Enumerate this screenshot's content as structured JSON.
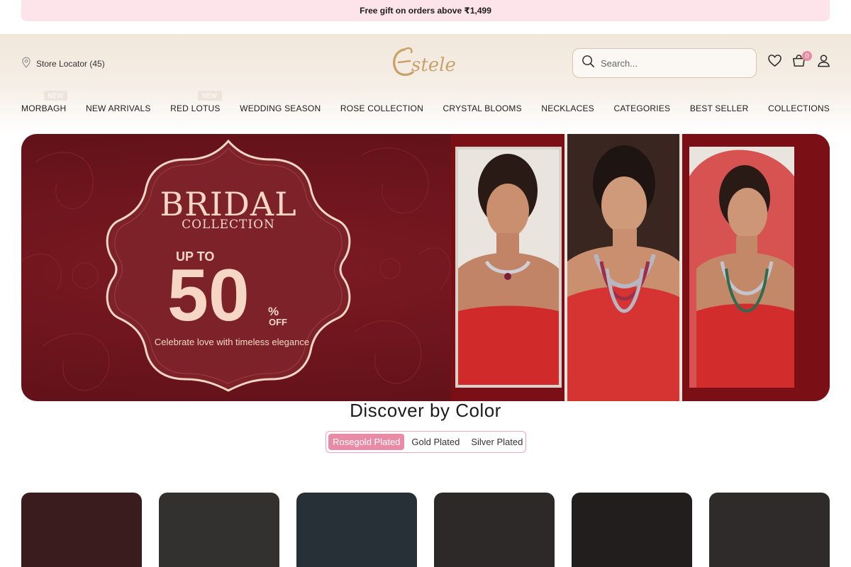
{
  "announcement": {
    "text": "Free gift on orders above ₹1,499"
  },
  "header": {
    "store_locator": "Store Locator (45)",
    "logo_text": "Estele",
    "search_placeholder": "Search...",
    "cart_count": "0"
  },
  "nav": {
    "items": [
      {
        "label": "MORBAGH",
        "badge": "NEW"
      },
      {
        "label": "NEW ARRIVALS"
      },
      {
        "label": "RED LOTUS",
        "badge": "NEW"
      },
      {
        "label": "WEDDING SEASON"
      },
      {
        "label": "ROSE COLLECTION"
      },
      {
        "label": "CRYSTAL BLOOMS"
      },
      {
        "label": "NECKLACES"
      },
      {
        "label": "CATEGORIES"
      },
      {
        "label": "BEST SELLER"
      },
      {
        "label": "COLLECTIONS"
      }
    ]
  },
  "hero": {
    "title": "BRIDAL",
    "subtitle": "COLLECTION",
    "up_to": "UP TO",
    "discount": "50",
    "percent": "%",
    "off": "OFF",
    "tagline": "Celebrate love with timeless elegance"
  },
  "discover": {
    "title": "Discover by Color",
    "options": [
      "Rosegold Plated",
      "Gold Plated",
      "Silver Plated"
    ],
    "active": "Rosegold Plated"
  },
  "colors": {
    "accent_pink": "#e98aa6",
    "banner_maroon": "#6a141c",
    "announce_bg": "#fde3ea",
    "card_colors": [
      "#3a1c1e",
      "#333030",
      "#263036",
      "#2d2928",
      "#221e1e",
      "#2e2b2a"
    ]
  }
}
